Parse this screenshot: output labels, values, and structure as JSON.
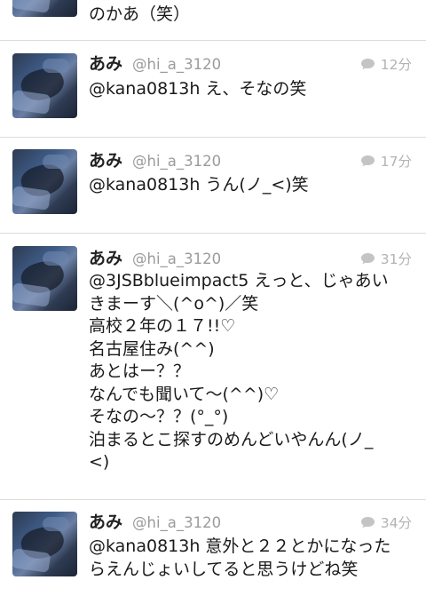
{
  "tweets": [
    {
      "text": "のかあ（笑）"
    },
    {
      "name": "あみ",
      "handle": "@hi_a_3120",
      "time": "12分",
      "text": "@kana0813h え、そなの笑"
    },
    {
      "name": "あみ",
      "handle": "@hi_a_3120",
      "time": "17分",
      "text": "@kana0813h うん(ノ_<)笑"
    },
    {
      "name": "あみ",
      "handle": "@hi_a_3120",
      "time": "31分",
      "text": "@3JSBblueimpact5 えっと、じゃあい\nきまーす＼(^o^)／笑\n高校２年の１７!!♡\n名古屋住み(^^)\nあとはー？？\nなんでも聞いて〜(^^)♡\nそなの〜？？(°_°)\n泊まるとこ探すのめんどいやんん(ノ_\n<)"
    },
    {
      "name": "あみ",
      "handle": "@hi_a_3120",
      "time": "34分",
      "text": "@kana0813h 意外と２２とかになった\nらえんじょいしてると思うけどね笑"
    }
  ],
  "icons": {
    "reply": "speech-bubble-icon"
  },
  "colors": {
    "name": "#222222",
    "handle": "#9b9b9b",
    "time": "#b3b3b3",
    "divider": "#dcdcdc"
  }
}
